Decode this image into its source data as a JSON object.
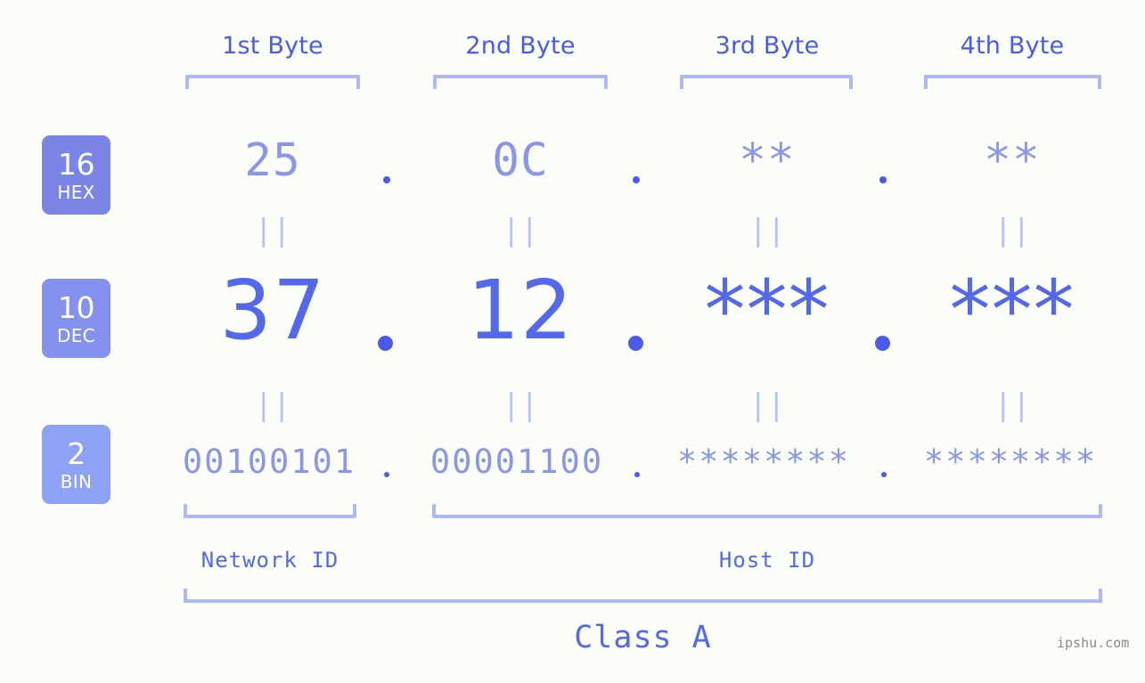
{
  "background": "#fbfdf9",
  "accent_dark": "#4a5bea",
  "accent_mid": "#5468ed",
  "accent_light": "#8a95ee",
  "accent_pale": "#aeb8f8",
  "byte_headers": [
    {
      "label": "1st Byte"
    },
    {
      "label": "2nd Byte"
    },
    {
      "label": "3rd Byte"
    },
    {
      "label": "4th Byte"
    }
  ],
  "rows": [
    {
      "base": "16",
      "base_abbr": "HEX",
      "badge_color": "#7b85e8",
      "values": [
        "25",
        "0C",
        "**",
        "**"
      ]
    },
    {
      "base": "10",
      "base_abbr": "DEC",
      "badge_color": "#8491ef",
      "values": [
        "37",
        "12",
        "***",
        "***"
      ]
    },
    {
      "base": "2",
      "base_abbr": "BIN",
      "badge_color": "#8ea2f5",
      "values": [
        "00100101",
        "00001100",
        "********",
        "********"
      ]
    }
  ],
  "separator": "||",
  "octet_dot": ".",
  "segments": [
    {
      "label": "Network ID"
    },
    {
      "label": "Host ID"
    }
  ],
  "class_label": "Class A",
  "watermark": "ipshu.com"
}
